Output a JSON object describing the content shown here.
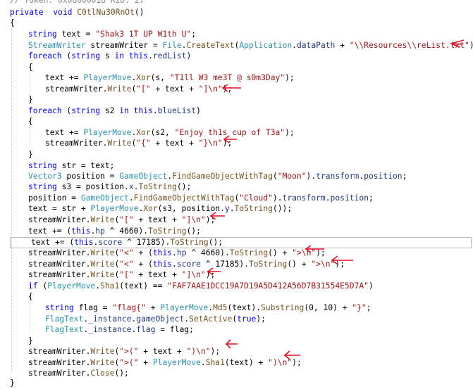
{
  "colors": {
    "keyword": "#0000ff",
    "type": "#2b91af",
    "string": "#a31515",
    "method": "#74531f",
    "property": "#1f377f",
    "annotation_arrow": "#e81123",
    "background": "#ffffff"
  },
  "code": {
    "header_comment": "// Token: 0x0600001B RID: 27",
    "lines": [
      {
        "id": "l1",
        "tokens": [
          [
            "kw",
            "private"
          ],
          [
            "",
            "  "
          ],
          [
            "kw",
            "void"
          ],
          [
            "",
            " "
          ],
          [
            "mth",
            "C0tlNu30RnOt"
          ],
          [
            "",
            "()"
          ]
        ]
      },
      {
        "id": "l2",
        "tokens": [
          [
            "",
            "{"
          ]
        ]
      },
      {
        "id": "l3",
        "tokens": [
          [
            "kw",
            "string"
          ],
          [
            "",
            " text = "
          ],
          [
            "str",
            "\"Shak3 1T UP W1th U\""
          ],
          [
            "",
            ";"
          ]
        ]
      },
      {
        "id": "l4",
        "tokens": [
          [
            "ty",
            "StreamWriter"
          ],
          [
            "",
            " streamWriter = "
          ],
          [
            "ty",
            "File"
          ],
          [
            "",
            "."
          ],
          [
            "mth",
            "CreateText"
          ],
          [
            "",
            "("
          ],
          [
            "ty",
            "Application"
          ],
          [
            "",
            "."
          ],
          [
            "prop",
            "dataPath"
          ],
          [
            "",
            " + "
          ],
          [
            "str",
            "\"\\\\Resources\\\\reList.txt\""
          ],
          [
            "",
            ");"
          ]
        ]
      },
      {
        "id": "l5",
        "tokens": [
          [
            "kw",
            "foreach"
          ],
          [
            "",
            " ("
          ],
          [
            "kw",
            "string"
          ],
          [
            "",
            " s "
          ],
          [
            "kw",
            "in"
          ],
          [
            "",
            " "
          ],
          [
            "kw",
            "this"
          ],
          [
            "",
            "."
          ],
          [
            "prop",
            "redList"
          ],
          [
            "",
            ")"
          ]
        ]
      },
      {
        "id": "l6",
        "tokens": [
          [
            "",
            "{"
          ]
        ]
      },
      {
        "id": "l7",
        "tokens": [
          [
            "",
            "text += "
          ],
          [
            "ty",
            "PlayerMove"
          ],
          [
            "",
            "."
          ],
          [
            "mth",
            "Xor"
          ],
          [
            "",
            "(s, "
          ],
          [
            "str",
            "\"T1ll W3 me3T @ s0m3Day\""
          ],
          [
            "",
            ");"
          ]
        ]
      },
      {
        "id": "l8",
        "tokens": [
          [
            "",
            "streamWriter."
          ],
          [
            "mth",
            "Write"
          ],
          [
            "",
            "("
          ],
          [
            "str",
            "\"[\""
          ],
          [
            "",
            " + text + "
          ],
          [
            "str",
            "\"]\\n\""
          ],
          [
            "",
            ");"
          ]
        ]
      },
      {
        "id": "l9",
        "tokens": [
          [
            "",
            "}"
          ]
        ]
      },
      {
        "id": "l10",
        "tokens": [
          [
            "kw",
            "foreach"
          ],
          [
            "",
            " ("
          ],
          [
            "kw",
            "string"
          ],
          [
            "",
            " s2 "
          ],
          [
            "kw",
            "in"
          ],
          [
            "",
            " "
          ],
          [
            "kw",
            "this"
          ],
          [
            "",
            "."
          ],
          [
            "prop",
            "blueList"
          ],
          [
            "",
            ")"
          ]
        ]
      },
      {
        "id": "l11",
        "tokens": [
          [
            "",
            "{"
          ]
        ]
      },
      {
        "id": "l12",
        "tokens": [
          [
            "",
            "text += "
          ],
          [
            "ty",
            "PlayerMove"
          ],
          [
            "",
            "."
          ],
          [
            "mth",
            "Xor"
          ],
          [
            "",
            "(s2, "
          ],
          [
            "str",
            "\"Enjoy th1s cup of T3a\""
          ],
          [
            "",
            ");"
          ]
        ]
      },
      {
        "id": "l13",
        "tokens": [
          [
            "",
            "streamWriter."
          ],
          [
            "mth",
            "Write"
          ],
          [
            "",
            "("
          ],
          [
            "str",
            "\"{\""
          ],
          [
            "",
            " + text + "
          ],
          [
            "str",
            "\"}\\n\""
          ],
          [
            "",
            ");"
          ]
        ]
      },
      {
        "id": "l14",
        "tokens": [
          [
            "",
            "}"
          ]
        ]
      },
      {
        "id": "l15",
        "tokens": [
          [
            "kw",
            "string"
          ],
          [
            "",
            " str = text;"
          ]
        ]
      },
      {
        "id": "l16",
        "tokens": [
          [
            "ty",
            "Vector3"
          ],
          [
            "",
            " position = "
          ],
          [
            "ty",
            "GameObject"
          ],
          [
            "",
            "."
          ],
          [
            "mth",
            "FindGameObjectWithTag"
          ],
          [
            "",
            "("
          ],
          [
            "str",
            "\"Moon\""
          ],
          [
            "",
            ")."
          ],
          [
            "prop",
            "transform"
          ],
          [
            "",
            "."
          ],
          [
            "prop",
            "position"
          ],
          [
            "",
            ";"
          ]
        ]
      },
      {
        "id": "l17",
        "tokens": [
          [
            "kw",
            "string"
          ],
          [
            "",
            " s3 = position."
          ],
          [
            "prop",
            "x"
          ],
          [
            "",
            "."
          ],
          [
            "mth",
            "ToString"
          ],
          [
            "",
            "();"
          ]
        ]
      },
      {
        "id": "l18",
        "tokens": [
          [
            "",
            "position = "
          ],
          [
            "ty",
            "GameObject"
          ],
          [
            "",
            "."
          ],
          [
            "mth",
            "FindGameObjectWithTag"
          ],
          [
            "",
            "("
          ],
          [
            "str",
            "\"Cloud\""
          ],
          [
            "",
            ")."
          ],
          [
            "prop",
            "transform"
          ],
          [
            "",
            "."
          ],
          [
            "prop",
            "position"
          ],
          [
            "",
            ";"
          ]
        ]
      },
      {
        "id": "l19",
        "tokens": [
          [
            "",
            "text = str + "
          ],
          [
            "ty",
            "PlayerMove"
          ],
          [
            "",
            "."
          ],
          [
            "mth",
            "Xor"
          ],
          [
            "",
            "(s3, position."
          ],
          [
            "prop",
            "y"
          ],
          [
            "",
            "."
          ],
          [
            "mth",
            "ToString"
          ],
          [
            "",
            "());"
          ]
        ]
      },
      {
        "id": "l20",
        "tokens": [
          [
            "",
            "streamWriter."
          ],
          [
            "mth",
            "Write"
          ],
          [
            "",
            "("
          ],
          [
            "str",
            "\"[\""
          ],
          [
            "",
            " + text + "
          ],
          [
            "str",
            "\"]\\n\""
          ],
          [
            "",
            ");"
          ]
        ]
      },
      {
        "id": "l21",
        "tokens": [
          [
            "",
            "text += ("
          ],
          [
            "kw",
            "this"
          ],
          [
            "",
            "."
          ],
          [
            "prop",
            "hp"
          ],
          [
            "",
            " ^ 4660)."
          ],
          [
            "mth",
            "ToString"
          ],
          [
            "",
            "();"
          ]
        ]
      },
      {
        "id": "l22",
        "tokens": [
          [
            "",
            "text += ("
          ],
          [
            "kw",
            "this"
          ],
          [
            "",
            "."
          ],
          [
            "prop",
            "score"
          ],
          [
            "",
            " ^ 17185)."
          ],
          [
            "mth",
            "ToString"
          ],
          [
            "",
            "();"
          ]
        ]
      },
      {
        "id": "l23",
        "tokens": [
          [
            "",
            "streamWriter."
          ],
          [
            "mth",
            "Write"
          ],
          [
            "",
            "("
          ],
          [
            "str",
            "\"<\""
          ],
          [
            "",
            " + ("
          ],
          [
            "kw",
            "this"
          ],
          [
            "",
            "."
          ],
          [
            "prop",
            "hp"
          ],
          [
            "",
            " ^ 4660)."
          ],
          [
            "mth",
            "ToString"
          ],
          [
            "",
            "() + "
          ],
          [
            "str",
            "\">\\n\""
          ],
          [
            "",
            ");"
          ]
        ]
      },
      {
        "id": "l24",
        "tokens": [
          [
            "",
            "streamWriter."
          ],
          [
            "mth",
            "Write"
          ],
          [
            "",
            "("
          ],
          [
            "str",
            "\"<\""
          ],
          [
            "",
            " + ("
          ],
          [
            "kw",
            "this"
          ],
          [
            "",
            "."
          ],
          [
            "prop",
            "score"
          ],
          [
            "",
            " ^ 17185)."
          ],
          [
            "mth",
            "ToString"
          ],
          [
            "",
            "() + "
          ],
          [
            "str",
            "\">\\n\""
          ],
          [
            "",
            ");"
          ]
        ]
      },
      {
        "id": "l25",
        "tokens": [
          [
            "",
            "streamWriter."
          ],
          [
            "mth",
            "Write"
          ],
          [
            "",
            "("
          ],
          [
            "str",
            "\"[\""
          ],
          [
            "",
            " + text + "
          ],
          [
            "str",
            "\"]\\n\""
          ],
          [
            "",
            ");"
          ]
        ]
      },
      {
        "id": "l26",
        "tokens": [
          [
            "kw",
            "if"
          ],
          [
            "",
            " ("
          ],
          [
            "ty",
            "PlayerMove"
          ],
          [
            "",
            "."
          ],
          [
            "mth",
            "Sha1"
          ],
          [
            "",
            "(text) == "
          ],
          [
            "str",
            "\"FAF7AAE1DCC19A7D19A5D412A56D7B31554E5D7A\""
          ],
          [
            "",
            ")"
          ]
        ]
      },
      {
        "id": "l27",
        "tokens": [
          [
            "",
            "{"
          ]
        ]
      },
      {
        "id": "l28",
        "tokens": [
          [
            "kw",
            "string"
          ],
          [
            "",
            " flag = "
          ],
          [
            "str",
            "\"flag{\""
          ],
          [
            "",
            " + "
          ],
          [
            "ty",
            "PlayerMove"
          ],
          [
            "",
            "."
          ],
          [
            "mth",
            "Md5"
          ],
          [
            "",
            "(text)."
          ],
          [
            "mth",
            "Substring"
          ],
          [
            "",
            "(0, 10) + "
          ],
          [
            "str",
            "\"}\""
          ],
          [
            "",
            ";"
          ]
        ]
      },
      {
        "id": "l29",
        "tokens": [
          [
            "ty",
            "FlagText"
          ],
          [
            "",
            "."
          ],
          [
            "prop",
            "_instance"
          ],
          [
            "",
            "."
          ],
          [
            "prop",
            "gameObject"
          ],
          [
            "",
            "."
          ],
          [
            "mth",
            "SetActive"
          ],
          [
            "",
            "("
          ],
          [
            "kw",
            "true"
          ],
          [
            "",
            ");"
          ]
        ]
      },
      {
        "id": "l30",
        "tokens": [
          [
            "ty",
            "FlagText"
          ],
          [
            "",
            "."
          ],
          [
            "prop",
            "_instance"
          ],
          [
            "",
            "."
          ],
          [
            "prop",
            "flag"
          ],
          [
            "",
            " = flag;"
          ]
        ]
      },
      {
        "id": "l31",
        "tokens": [
          [
            "",
            "}"
          ]
        ]
      },
      {
        "id": "l32",
        "tokens": [
          [
            "",
            "streamWriter."
          ],
          [
            "mth",
            "Write"
          ],
          [
            "",
            "("
          ],
          [
            "str",
            "\">(\""
          ],
          [
            "",
            " + text + "
          ],
          [
            "str",
            "\")\\n\""
          ],
          [
            "",
            ");"
          ]
        ]
      },
      {
        "id": "l33",
        "tokens": [
          [
            "",
            "streamWriter."
          ],
          [
            "mth",
            "Write"
          ],
          [
            "",
            "("
          ],
          [
            "str",
            "\">(\""
          ],
          [
            "",
            " + "
          ],
          [
            "ty",
            "PlayerMove"
          ],
          [
            "",
            "."
          ],
          [
            "mth",
            "Sha1"
          ],
          [
            "",
            "(text) + "
          ],
          [
            "str",
            "\")\\n\""
          ],
          [
            "",
            ");"
          ]
        ]
      },
      {
        "id": "l34",
        "tokens": [
          [
            "",
            "streamWriter."
          ],
          [
            "mth",
            "Close"
          ],
          [
            "",
            "();"
          ]
        ]
      },
      {
        "id": "l35",
        "tokens": [
          [
            "",
            "}"
          ]
        ]
      }
    ]
  }
}
